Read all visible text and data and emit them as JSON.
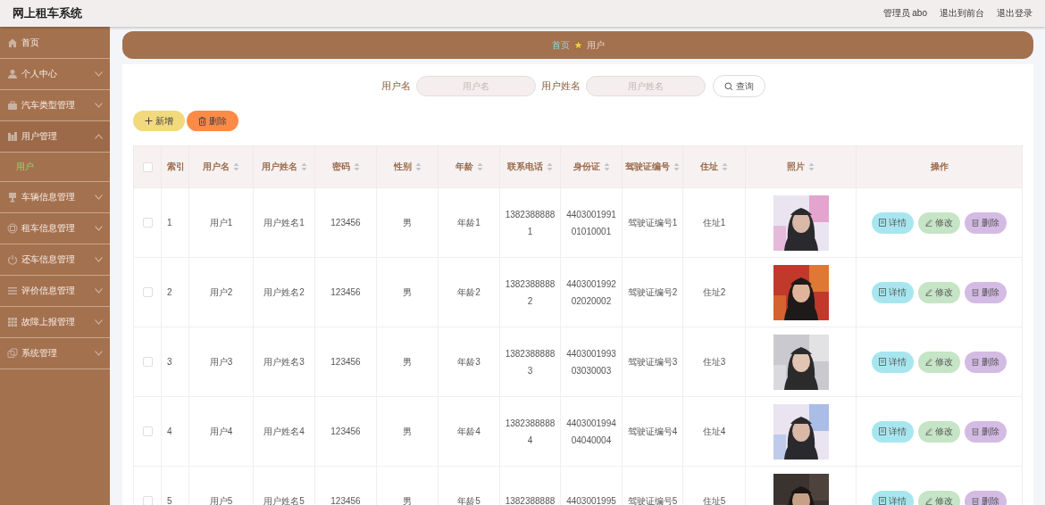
{
  "header": {
    "title": "网上租车系统",
    "links": [
      "管理员 abo",
      "退出到前台",
      "退出登录"
    ]
  },
  "sidebar": {
    "items": [
      {
        "label": "首页",
        "expandable": false
      },
      {
        "label": "个人中心",
        "expandable": true,
        "expanded": false
      },
      {
        "label": "汽车类型管理",
        "expandable": true,
        "expanded": false
      },
      {
        "label": "用户管理",
        "expandable": true,
        "expanded": true,
        "children": [
          {
            "label": "用户",
            "selected": true
          }
        ]
      },
      {
        "label": "车辆信息管理",
        "expandable": true,
        "expanded": false
      },
      {
        "label": "租车信息管理",
        "expandable": true,
        "expanded": false
      },
      {
        "label": "还车信息管理",
        "expandable": true,
        "expanded": false
      },
      {
        "label": "评价信息管理",
        "expandable": true,
        "expanded": false
      },
      {
        "label": "故障上报管理",
        "expandable": true,
        "expanded": false
      },
      {
        "label": "系统管理",
        "expandable": true,
        "expanded": false
      }
    ]
  },
  "breadcrumb": [
    "首页",
    "用户"
  ],
  "search": {
    "fields": [
      {
        "label": "用户名",
        "placeholder": "用户名"
      },
      {
        "label": "用户姓名",
        "placeholder": "用户姓名"
      }
    ],
    "button": "查询"
  },
  "toolbar": [
    {
      "kind": "add",
      "label": "新增"
    },
    {
      "kind": "delete",
      "label": "删除"
    }
  ],
  "table": {
    "select_all": {
      "checked": false
    },
    "columns": [
      {
        "label": "索引",
        "sortable": false
      },
      {
        "label": "用户名",
        "sortable": true
      },
      {
        "label": "用户姓名",
        "sortable": true
      },
      {
        "label": "密码",
        "sortable": true
      },
      {
        "label": "性别",
        "sortable": true
      },
      {
        "label": "年龄",
        "sortable": true
      },
      {
        "label": "联系电话",
        "sortable": true
      },
      {
        "label": "身份证",
        "sortable": true
      },
      {
        "label": "驾驶证编号",
        "sortable": true
      },
      {
        "label": "住址",
        "sortable": true
      },
      {
        "label": "照片",
        "sortable": true
      },
      {
        "label": "操作",
        "sortable": false
      }
    ],
    "rows": [
      {
        "selected": false,
        "cells": [
          "1",
          "用户1",
          "用户姓名1",
          "123456",
          "男",
          "年龄1",
          "13823888881",
          "440300199101010001",
          "驾驶证编号1",
          "住址1"
        ],
        "actions": [
          "详情",
          "修改",
          "删除"
        ]
      },
      {
        "selected": false,
        "cells": [
          "2",
          "用户2",
          "用户姓名2",
          "123456",
          "男",
          "年龄2",
          "13823888882",
          "440300199202020002",
          "驾驶证编号2",
          "住址2"
        ],
        "actions": [
          "详情",
          "修改",
          "删除"
        ]
      },
      {
        "selected": false,
        "cells": [
          "3",
          "用户3",
          "用户姓名3",
          "123456",
          "男",
          "年龄3",
          "13823888883",
          "440300199303030003",
          "驾驶证编号3",
          "住址3"
        ],
        "actions": [
          "详情",
          "修改",
          "删除"
        ]
      },
      {
        "selected": false,
        "cells": [
          "4",
          "用户4",
          "用户姓名4",
          "123456",
          "男",
          "年龄4",
          "13823888884",
          "440300199404040004",
          "驾驶证编号4",
          "住址4"
        ],
        "actions": [
          "详情",
          "修改",
          "删除"
        ]
      },
      {
        "selected": false,
        "cells": [
          "5",
          "用户5",
          "用户姓名5",
          "123456",
          "男",
          "年龄5",
          "1382388888",
          "4403001995",
          "驾驶证编号5",
          "住址5"
        ],
        "actions": [
          "详情",
          "修改",
          "删除"
        ]
      }
    ]
  }
}
